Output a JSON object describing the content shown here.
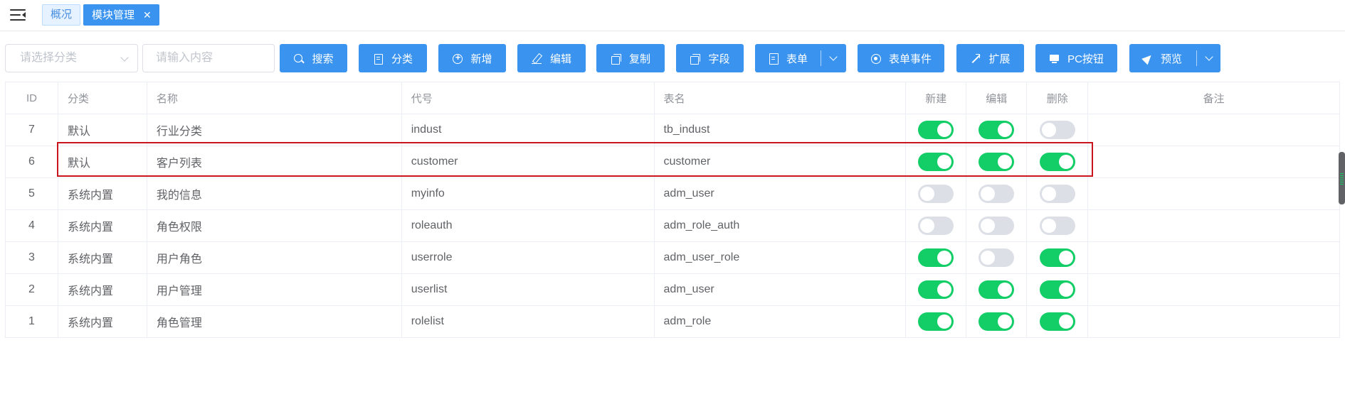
{
  "tabs": {
    "overview": "概况",
    "module": "模块管理",
    "close_symbol": "✕"
  },
  "toolbar": {
    "category_placeholder": "请选择分类",
    "search_placeholder": "请输入内容",
    "search": "搜索",
    "category": "分类",
    "add": "新增",
    "edit": "编辑",
    "copy": "复制",
    "field": "字段",
    "form": "表单",
    "form_event": "表单事件",
    "extend": "扩展",
    "pc_button": "PC按钮",
    "preview": "预览"
  },
  "table": {
    "headers": {
      "id": "ID",
      "category": "分类",
      "name": "名称",
      "code": "代号",
      "table": "表名",
      "new": "新建",
      "edit": "编辑",
      "delete": "删除",
      "note": "备注"
    },
    "rows": [
      {
        "id": "7",
        "category": "默认",
        "name": "行业分类",
        "code": "indust",
        "table": "tb_indust",
        "new": true,
        "edit": true,
        "delete": false
      },
      {
        "id": "6",
        "category": "默认",
        "name": "客户列表",
        "code": "customer",
        "table": "customer",
        "new": true,
        "edit": true,
        "delete": true
      },
      {
        "id": "5",
        "category": "系统内置",
        "name": "我的信息",
        "code": "myinfo",
        "table": "adm_user",
        "new": false,
        "edit": false,
        "delete": false
      },
      {
        "id": "4",
        "category": "系统内置",
        "name": "角色权限",
        "code": "roleauth",
        "table": "adm_role_auth",
        "new": false,
        "edit": false,
        "delete": false
      },
      {
        "id": "3",
        "category": "系统内置",
        "name": "用户角色",
        "code": "userrole",
        "table": "adm_user_role",
        "new": true,
        "edit": false,
        "delete": true
      },
      {
        "id": "2",
        "category": "系统内置",
        "name": "用户管理",
        "code": "userlist",
        "table": "adm_user",
        "new": true,
        "edit": true,
        "delete": true
      },
      {
        "id": "1",
        "category": "系统内置",
        "name": "角色管理",
        "code": "rolelist",
        "table": "adm_role",
        "new": true,
        "edit": true,
        "delete": true
      }
    ]
  },
  "colors": {
    "primary": "#3a94ef",
    "switch_on": "#13ce66",
    "switch_off": "#dcdfe6",
    "highlight": "#c9151e"
  },
  "icons": {
    "menu": "menu-fold-icon",
    "search": "search-icon",
    "category": "book-icon",
    "add": "plus-circle-icon",
    "edit": "pencil-icon",
    "copy": "copy-icon",
    "field": "copy-icon",
    "form": "document-icon",
    "form_event": "target-icon",
    "extend": "expand-icon",
    "pc_button": "monitor-icon",
    "preview": "send-icon"
  }
}
